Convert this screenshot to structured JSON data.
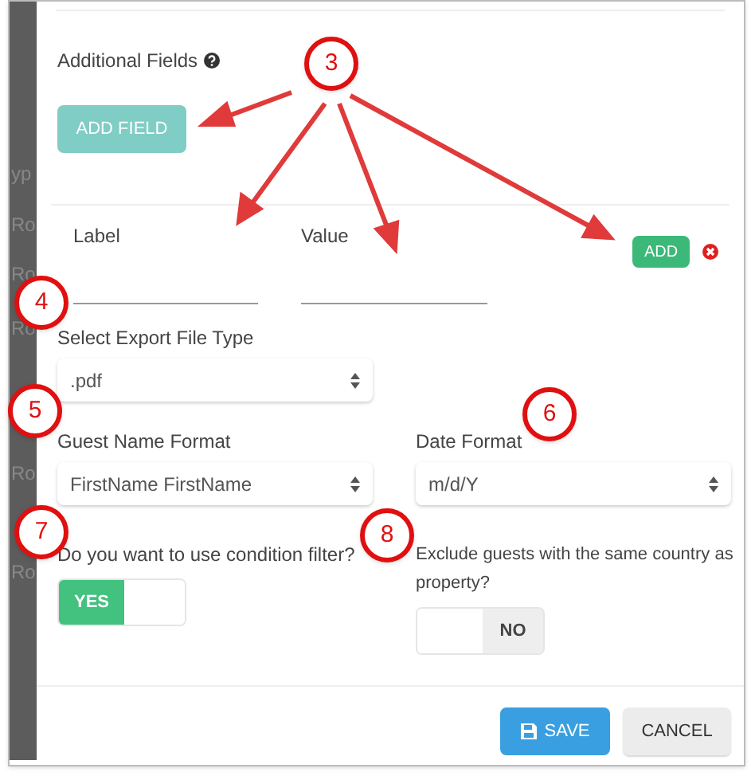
{
  "background_fragments": [
    "yp",
    "Ro",
    "Ro",
    "Ro",
    "Ro",
    "Ro"
  ],
  "additional_fields": {
    "title": "Additional Fields",
    "add_field_button": "ADD FIELD",
    "label_column": "Label",
    "value_column": "Value",
    "add_button": "ADD"
  },
  "export_file_type": {
    "label": "Select Export File Type",
    "value": ".pdf"
  },
  "guest_name_format": {
    "label": "Guest Name Format",
    "value": "FirstName FirstName"
  },
  "date_format": {
    "label": "Date Format",
    "value": "m/d/Y"
  },
  "condition_filter": {
    "label": "Do you want to use condition filter?",
    "on": true,
    "state_label": "YES"
  },
  "exclude_same_country": {
    "label": "Exclude guests with the same country as property?",
    "on": false,
    "state_label": "NO"
  },
  "buttons": [
    {
      "kind": "primary",
      "label": "SAVE"
    },
    {
      "kind": "secondary",
      "label": "CANCEL"
    }
  ],
  "callouts": [
    {
      "number": "3"
    },
    {
      "number": "4"
    },
    {
      "number": "5"
    },
    {
      "number": "6"
    },
    {
      "number": "7"
    },
    {
      "number": "8"
    }
  ]
}
